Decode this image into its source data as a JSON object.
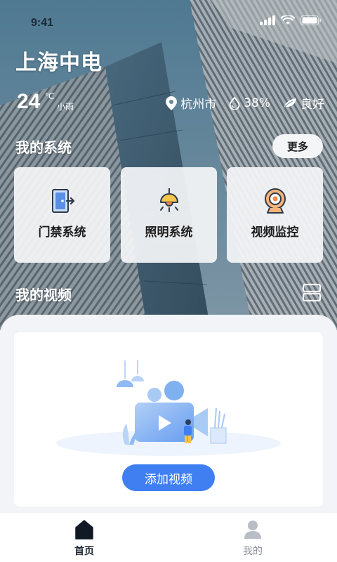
{
  "status_bar": {
    "time": "9:41"
  },
  "header": {
    "title": "上海中电"
  },
  "weather": {
    "temperature": "24",
    "unit": "℃",
    "condition": "小雨",
    "city": "杭州市",
    "humidity": "38%",
    "air_quality": "良好",
    "icons": [
      "location-pin-icon",
      "humidity-drop-icon",
      "leaf-icon"
    ]
  },
  "systems": {
    "title": "我的系统",
    "more_label": "更多",
    "items": [
      {
        "label": "门禁系统",
        "icon": "door-access-icon"
      },
      {
        "label": "照明系统",
        "icon": "lamp-icon"
      },
      {
        "label": "视频监控",
        "icon": "camera-icon"
      }
    ]
  },
  "videos": {
    "title": "我的视频",
    "add_label": "添加视频",
    "toggle_icon": "layout-toggle-icon"
  },
  "tabs": [
    {
      "label": "首页",
      "icon": "home-icon",
      "active": true
    },
    {
      "label": "我的",
      "icon": "user-icon",
      "active": false
    }
  ],
  "colors": {
    "accent": "#3f7ff2",
    "icon_orange": "#f08a4b",
    "icon_blue": "#4a7fd4",
    "lamp_yellow": "#f6c54a"
  }
}
